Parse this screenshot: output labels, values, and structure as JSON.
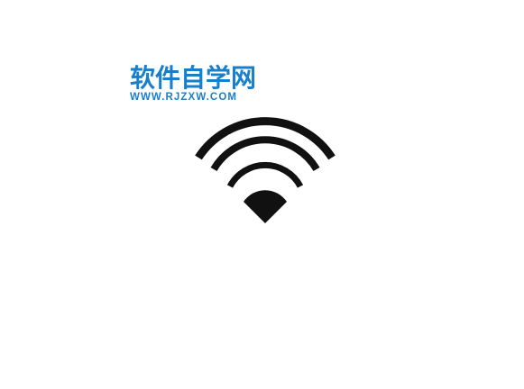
{
  "watermark": {
    "title": "软件自学网",
    "url": "WWW.RJZXW.COM",
    "color": "#1a7fc9"
  },
  "illustration": {
    "icon": "wifi-icon",
    "color": "#111111"
  }
}
